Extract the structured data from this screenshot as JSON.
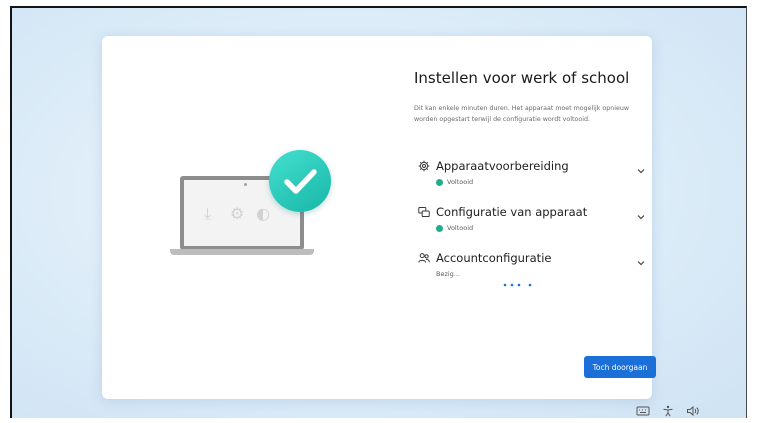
{
  "setup": {
    "title": "Instellen voor werk of school",
    "description": "Dit kan enkele minuten duren. Het apparaat moet mogelijk opnieuw worden opgestart terwijl de configuratie wordt voltooid.",
    "steps": [
      {
        "icon": "gear-icon",
        "label": "Apparaatvoorbereiding",
        "status": "Voltooid",
        "state": "complete"
      },
      {
        "icon": "device-config-icon",
        "label": "Configuratie van apparaat",
        "status": "Voltooid",
        "state": "complete"
      },
      {
        "icon": "people-icon",
        "label": "Accountconfiguratie",
        "status": "Bezig...",
        "state": "in-progress"
      }
    ],
    "continue_label": "Toch doorgaan"
  },
  "colors": {
    "accent": "#1a6fd8",
    "success": "#1fae8d",
    "check_badge": "#2cc9b8"
  },
  "taskbar": {
    "icons": [
      "keyboard-icon",
      "accessibility-icon",
      "volume-icon"
    ]
  }
}
